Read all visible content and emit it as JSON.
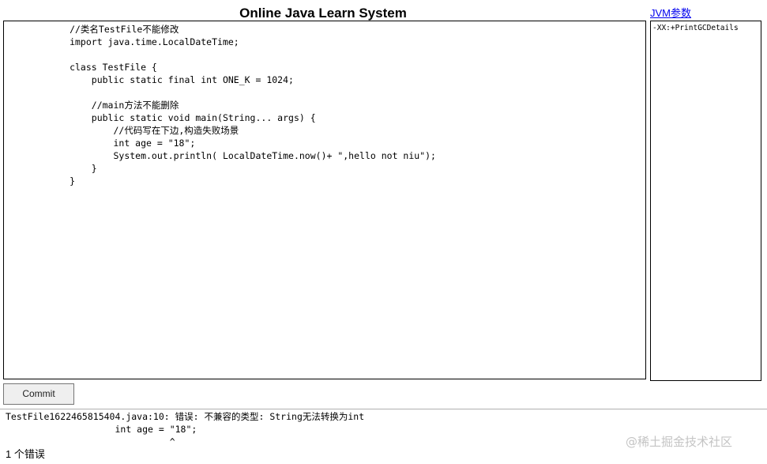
{
  "header": {
    "title": "Online Java Learn System",
    "jvm_link_label": "JVM参数"
  },
  "editor": {
    "lines": [
      "            //类名TestFile不能修改",
      "            import java.time.LocalDateTime;",
      "",
      "            class TestFile {",
      "                public static final int ONE_K = 1024;",
      "",
      "                //main方法不能删除",
      "                public static void main(String... args) {",
      "                    //代码写在下边,构造失败场景",
      "                    int age = \"18\";",
      "                    System.out.println( LocalDateTime.now()+ \",hello not niu\");",
      "                }",
      "            }"
    ]
  },
  "jvm_params": {
    "value": "-XX:+PrintGCDetails"
  },
  "toolbar": {
    "commit_label": "Commit"
  },
  "output": {
    "lines": [
      "TestFile1622465815404.java:10: 错误: 不兼容的类型: String无法转换为int",
      "                    int age = \"18\";",
      "                              ^",
      "1 个错误"
    ]
  },
  "watermark": {
    "text": "@稀土掘金技术社区"
  }
}
